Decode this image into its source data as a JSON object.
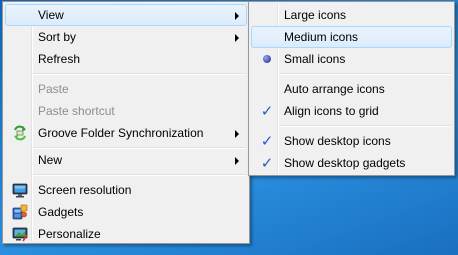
{
  "context_menu": {
    "items": [
      {
        "label": "View"
      },
      {
        "label": "Sort by"
      },
      {
        "label": "Refresh"
      },
      {
        "label": "Paste"
      },
      {
        "label": "Paste shortcut"
      },
      {
        "label": "Groove Folder Synchronization"
      },
      {
        "label": "New"
      },
      {
        "label": "Screen resolution"
      },
      {
        "label": "Gadgets"
      },
      {
        "label": "Personalize"
      }
    ]
  },
  "view_submenu": {
    "items": [
      {
        "label": "Large icons"
      },
      {
        "label": "Medium icons"
      },
      {
        "label": "Small icons",
        "selected": true
      },
      {
        "label": "Auto arrange icons"
      },
      {
        "label": "Align icons to grid",
        "checked": true
      },
      {
        "label": "Show desktop icons",
        "checked": true
      },
      {
        "label": "Show desktop gadgets",
        "checked": true
      }
    ],
    "check_glyph": "✓"
  },
  "colors": {
    "desktop": "#1c7fd0",
    "menu_bg": "#f0f0f0",
    "highlight": "#dcebfc",
    "disabled_text": "#8d8d8d",
    "check": "#2a5cc8"
  }
}
